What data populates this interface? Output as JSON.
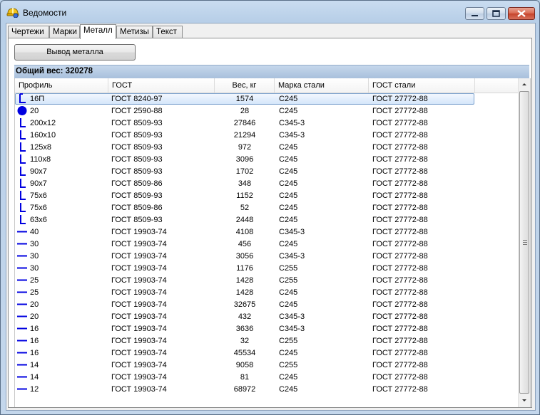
{
  "window": {
    "title": "Ведомости"
  },
  "tabs": [
    {
      "label": "Чертежи"
    },
    {
      "label": "Марки"
    },
    {
      "label": "Металл"
    },
    {
      "label": "Метизы"
    },
    {
      "label": "Текст"
    }
  ],
  "active_tab": "Металл",
  "toolbar": {
    "output_button": "Вывод металла"
  },
  "summary": {
    "total_weight": "Общий вес: 320278"
  },
  "table": {
    "columns": [
      "Профиль",
      "ГОСТ",
      "Вес, кг",
      "Марка стали",
      "ГОСТ стали"
    ],
    "rows": [
      {
        "icon": "channel-icon",
        "profile": "16П",
        "gost": "ГОСТ 8240-97",
        "weight": "1574",
        "grade": "С245",
        "steel_gost": "ГОСТ 27772-88"
      },
      {
        "icon": "round-bar-icon",
        "profile": "20",
        "gost": "ГОСТ 2590-88",
        "weight": "28",
        "grade": "С245",
        "steel_gost": "ГОСТ 27772-88"
      },
      {
        "icon": "angle-icon",
        "profile": "200x12",
        "gost": "ГОСТ 8509-93",
        "weight": "27846",
        "grade": "С345-3",
        "steel_gost": "ГОСТ 27772-88"
      },
      {
        "icon": "angle-icon",
        "profile": "160x10",
        "gost": "ГОСТ 8509-93",
        "weight": "21294",
        "grade": "С345-3",
        "steel_gost": "ГОСТ 27772-88"
      },
      {
        "icon": "angle-icon",
        "profile": "125x8",
        "gost": "ГОСТ 8509-93",
        "weight": "972",
        "grade": "С245",
        "steel_gost": "ГОСТ 27772-88"
      },
      {
        "icon": "angle-icon",
        "profile": "110x8",
        "gost": "ГОСТ 8509-93",
        "weight": "3096",
        "grade": "С245",
        "steel_gost": "ГОСТ 27772-88"
      },
      {
        "icon": "angle-icon",
        "profile": "90x7",
        "gost": "ГОСТ 8509-93",
        "weight": "1702",
        "grade": "С245",
        "steel_gost": "ГОСТ 27772-88"
      },
      {
        "icon": "angle-icon",
        "profile": "90x7",
        "gost": "ГОСТ 8509-86",
        "weight": "348",
        "grade": "С245",
        "steel_gost": "ГОСТ 27772-88"
      },
      {
        "icon": "angle-icon",
        "profile": "75x6",
        "gost": "ГОСТ 8509-93",
        "weight": "1152",
        "grade": "С245",
        "steel_gost": "ГОСТ 27772-88"
      },
      {
        "icon": "angle-icon",
        "profile": "75x6",
        "gost": "ГОСТ 8509-86",
        "weight": "52",
        "grade": "С245",
        "steel_gost": "ГОСТ 27772-88"
      },
      {
        "icon": "angle-icon",
        "profile": "63x6",
        "gost": "ГОСТ 8509-93",
        "weight": "2448",
        "grade": "С245",
        "steel_gost": "ГОСТ 27772-88"
      },
      {
        "icon": "plate-icon",
        "profile": "40",
        "gost": "ГОСТ 19903-74",
        "weight": "4108",
        "grade": "С345-3",
        "steel_gost": "ГОСТ 27772-88"
      },
      {
        "icon": "plate-icon",
        "profile": "30",
        "gost": "ГОСТ 19903-74",
        "weight": "456",
        "grade": "С245",
        "steel_gost": "ГОСТ 27772-88"
      },
      {
        "icon": "plate-icon",
        "profile": "30",
        "gost": "ГОСТ 19903-74",
        "weight": "3056",
        "grade": "С345-3",
        "steel_gost": "ГОСТ 27772-88"
      },
      {
        "icon": "plate-icon",
        "profile": "30",
        "gost": "ГОСТ 19903-74",
        "weight": "1176",
        "grade": "С255",
        "steel_gost": "ГОСТ 27772-88"
      },
      {
        "icon": "plate-icon",
        "profile": "25",
        "gost": "ГОСТ 19903-74",
        "weight": "1428",
        "grade": "С255",
        "steel_gost": "ГОСТ 27772-88"
      },
      {
        "icon": "plate-icon",
        "profile": "25",
        "gost": "ГОСТ 19903-74",
        "weight": "1428",
        "grade": "С245",
        "steel_gost": "ГОСТ 27772-88"
      },
      {
        "icon": "plate-icon",
        "profile": "20",
        "gost": "ГОСТ 19903-74",
        "weight": "32675",
        "grade": "С245",
        "steel_gost": "ГОСТ 27772-88"
      },
      {
        "icon": "plate-icon",
        "profile": "20",
        "gost": "ГОСТ 19903-74",
        "weight": "432",
        "grade": "С345-3",
        "steel_gost": "ГОСТ 27772-88"
      },
      {
        "icon": "plate-icon",
        "profile": "16",
        "gost": "ГОСТ 19903-74",
        "weight": "3636",
        "grade": "С345-3",
        "steel_gost": "ГОСТ 27772-88"
      },
      {
        "icon": "plate-icon",
        "profile": "16",
        "gost": "ГОСТ 19903-74",
        "weight": "32",
        "grade": "С255",
        "steel_gost": "ГОСТ 27772-88"
      },
      {
        "icon": "plate-icon",
        "profile": "16",
        "gost": "ГОСТ 19903-74",
        "weight": "45534",
        "grade": "С245",
        "steel_gost": "ГОСТ 27772-88"
      },
      {
        "icon": "plate-icon",
        "profile": "14",
        "gost": "ГОСТ 19903-74",
        "weight": "9058",
        "grade": "С255",
        "steel_gost": "ГОСТ 27772-88"
      },
      {
        "icon": "plate-icon",
        "profile": "14",
        "gost": "ГОСТ 19903-74",
        "weight": "81",
        "grade": "С245",
        "steel_gost": "ГОСТ 27772-88"
      },
      {
        "icon": "plate-icon",
        "profile": "12",
        "gost": "ГОСТ 19903-74",
        "weight": "68972",
        "grade": "С245",
        "steel_gost": "ГОСТ 27772-88"
      }
    ],
    "selected_row": 0
  },
  "colors": {
    "icon_blue": "#0000e0",
    "selection_border": "#7da2ce",
    "summary_bar": "#b3c9e3"
  }
}
